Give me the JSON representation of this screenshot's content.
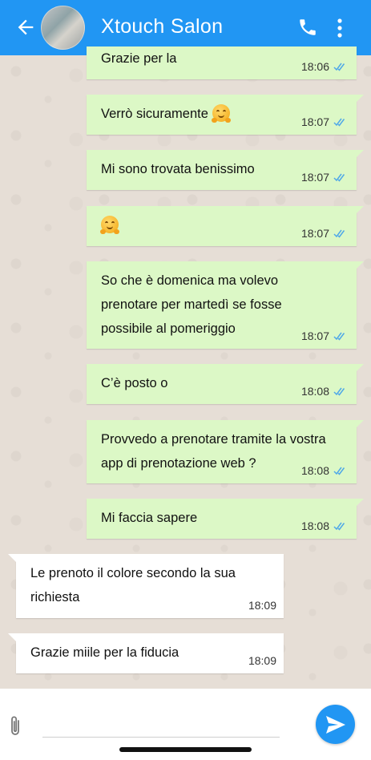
{
  "header": {
    "contact_name": "Xtouch Salon",
    "back_icon": "arrow-left-icon",
    "call_icon": "phone-icon",
    "menu_icon": "more-vertical-icon",
    "color": "#2196f3"
  },
  "messages": [
    {
      "direction": "outgoing",
      "text": "Grazie per la",
      "time": "18:06",
      "status": "read"
    },
    {
      "direction": "outgoing",
      "text": "Verrò sicuramente",
      "emoji": "hugging-face",
      "time": "18:07",
      "status": "read"
    },
    {
      "direction": "outgoing",
      "text": "Mi sono trovata benissimo",
      "time": "18:07",
      "status": "read"
    },
    {
      "direction": "outgoing",
      "text": "",
      "emoji": "hugging-face",
      "time": "18:07",
      "status": "read"
    },
    {
      "direction": "outgoing",
      "lines": [
        "So che è domenica ma volevo",
        "prenotare per martedì se fosse",
        "possibile al pomeriggio"
      ],
      "time": "18:07",
      "status": "read"
    },
    {
      "direction": "outgoing",
      "text": "C’è posto o",
      "time": "18:08",
      "status": "read"
    },
    {
      "direction": "outgoing",
      "lines": [
        "Provvedo a prenotare tramite la vostra",
        "app di prenotazione web ?"
      ],
      "time": "18:08",
      "status": "read"
    },
    {
      "direction": "outgoing",
      "text": "Mi faccia sapere",
      "time": "18:08",
      "status": "read"
    },
    {
      "direction": "incoming",
      "lines": [
        "Le prenoto il colore secondo la sua",
        "richiesta"
      ],
      "time": "18:09"
    },
    {
      "direction": "incoming",
      "text": "Grazie miile per la fiducia",
      "time": "18:09"
    }
  ],
  "composer": {
    "placeholder": "",
    "attach_icon": "paperclip-icon",
    "send_icon": "send-icon"
  },
  "colors": {
    "outgoing_bubble": "#dcf8c6",
    "incoming_bubble": "#ffffff",
    "read_ticks": "#4fa8e8"
  }
}
